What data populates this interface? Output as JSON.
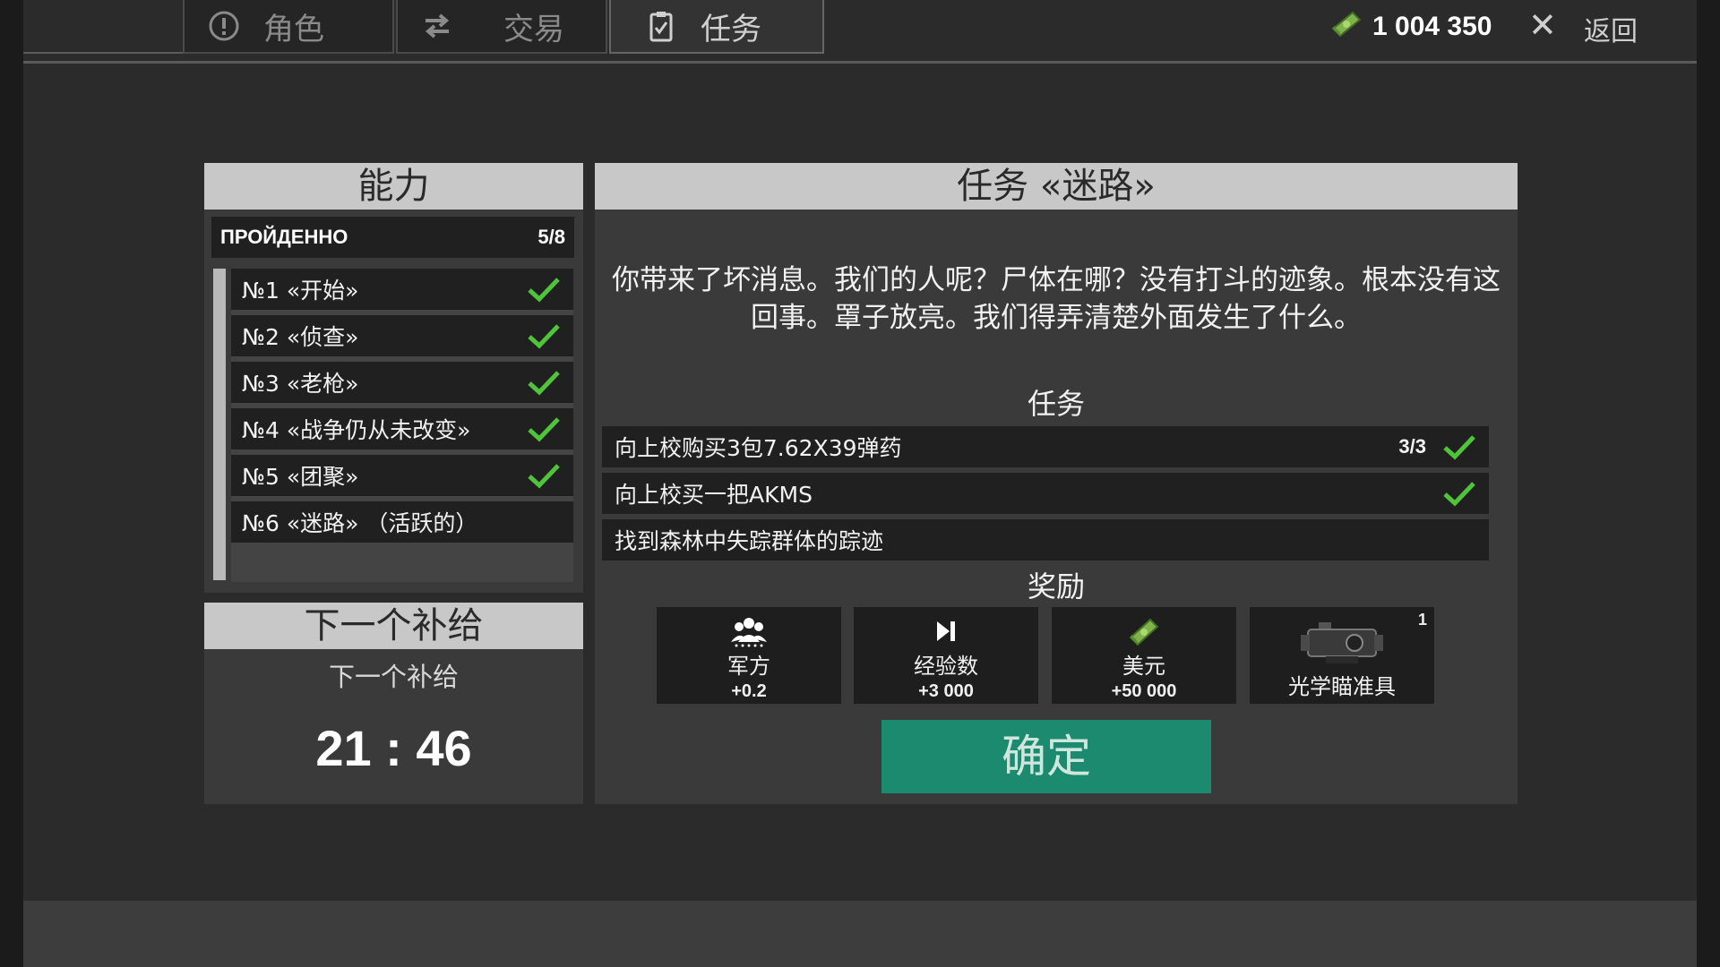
{
  "tabs": [
    {
      "label": "角色",
      "icon": "alert-circle-icon"
    },
    {
      "label": "交易",
      "icon": "swap-arrows-icon"
    },
    {
      "label": "任务",
      "icon": "clipboard-check-icon"
    }
  ],
  "wallet": {
    "amount": "1 004 350",
    "icon": "cash-icon"
  },
  "nav": {
    "close_symbol": "✕",
    "back_label": "返回"
  },
  "ability_panel": {
    "title": "能力",
    "passed_label": "ПРОЙДЕННО",
    "passed_count": "5/8",
    "missions": [
      {
        "label": "№1 «开始»",
        "completed": true
      },
      {
        "label": "№2 «侦查»",
        "completed": true
      },
      {
        "label": "№3 «老枪»",
        "completed": true
      },
      {
        "label": "№4 «战争仍从未改变»",
        "completed": true
      },
      {
        "label": "№5 «团聚»",
        "completed": true
      },
      {
        "label": "№6 «迷路» （活跃的）",
        "completed": false
      }
    ]
  },
  "supply_panel": {
    "title": "下一个补给",
    "subtitle": "下一个补给",
    "timer": "21 : 46"
  },
  "quest_panel": {
    "title": "任务 «迷路»",
    "story": "你带来了坏消息。我们的人呢？尸体在哪？没有打斗的迹象。根本没有这回事。罩子放亮。我们得弄清楚外面发生了什么。",
    "tasks_title": "任务",
    "tasks": [
      {
        "label": "向上校购买3包7.62X39弹药",
        "progress": "3/3",
        "completed": true
      },
      {
        "label": "向上校买一把AKMS",
        "progress": "",
        "completed": true
      },
      {
        "label": "找到森林中失踪群体的踪迹",
        "progress": "",
        "completed": false
      }
    ],
    "rewards_title": "奖励",
    "rewards": [
      {
        "label": "军方",
        "value": "+0.2",
        "icon": "military-group-icon",
        "count": ""
      },
      {
        "label": "经验数",
        "value": "+3 000",
        "icon": "experience-skip-icon",
        "count": ""
      },
      {
        "label": "美元",
        "value": "+50 000",
        "icon": "cash-icon",
        "count": ""
      },
      {
        "label": "光学瞄准具",
        "value": "",
        "icon": "optical-scope-icon",
        "count": "1"
      }
    ],
    "confirm_label": "确定"
  },
  "colors": {
    "check": "#4fc43a",
    "confirm_button": "#1c8a6e",
    "panel_header": "#c8c8c8"
  }
}
